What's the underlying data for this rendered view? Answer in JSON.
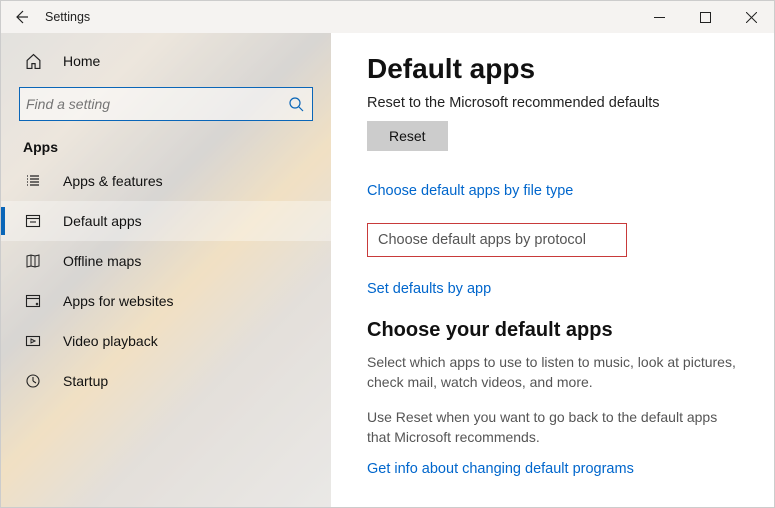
{
  "window": {
    "title": "Settings"
  },
  "sidebar": {
    "home": "Home",
    "search_placeholder": "Find a setting",
    "section": "Apps",
    "items": [
      {
        "label": "Apps & features"
      },
      {
        "label": "Default apps"
      },
      {
        "label": "Offline maps"
      },
      {
        "label": "Apps for websites"
      },
      {
        "label": "Video playback"
      },
      {
        "label": "Startup"
      }
    ]
  },
  "content": {
    "heading": "Default apps",
    "reset_caption": "Reset to the Microsoft recommended defaults",
    "reset_button": "Reset",
    "link_filetype": "Choose default apps by file type",
    "link_protocol": "Choose default apps by protocol",
    "link_byapp": "Set defaults by app",
    "choose_heading": "Choose your default apps",
    "choose_para1": "Select which apps to use to listen to music, look at pictures, check mail, watch videos, and more.",
    "choose_para2": "Use Reset when you want to go back to the default apps that Microsoft recommends.",
    "info_link": "Get info about changing default programs"
  }
}
